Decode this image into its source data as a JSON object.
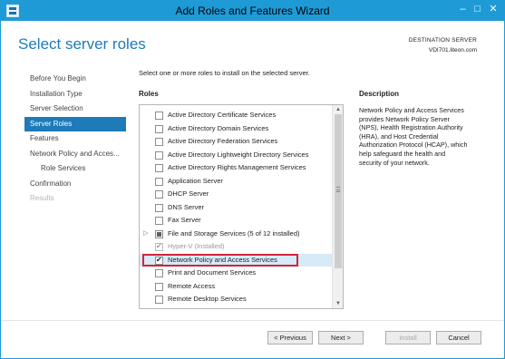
{
  "window": {
    "title": "Add Roles and Features Wizard",
    "minimize_glyph": "–",
    "maximize_glyph": "□",
    "close_glyph": "✕"
  },
  "header": {
    "page_title": "Select server roles",
    "destination_label": "DESTINATION SERVER",
    "destination_server": "VDI701.liteon.com"
  },
  "nav": {
    "items": [
      {
        "label": "Before You Begin",
        "state": "normal"
      },
      {
        "label": "Installation Type",
        "state": "normal"
      },
      {
        "label": "Server Selection",
        "state": "normal"
      },
      {
        "label": "Server Roles",
        "state": "active"
      },
      {
        "label": "Features",
        "state": "normal"
      },
      {
        "label": "Network Policy and Acces...",
        "state": "normal"
      },
      {
        "label": "Role Services",
        "state": "sub"
      },
      {
        "label": "Confirmation",
        "state": "normal"
      },
      {
        "label": "Results",
        "state": "disabled"
      }
    ]
  },
  "main": {
    "instruction": "Select one or more roles to install on the selected server.",
    "roles_heading": "Roles",
    "description_heading": "Description",
    "description_text": "Network Policy and Access Services provides Network Policy Server (NPS), Health Registration Authority (HRA), and Host Credential Authorization Protocol (HCAP), which help safeguard the health and security of your network.",
    "roles": [
      {
        "label": "Active Directory Certificate Services",
        "checked": false
      },
      {
        "label": "Active Directory Domain Services",
        "checked": false
      },
      {
        "label": "Active Directory Federation Services",
        "checked": false
      },
      {
        "label": "Active Directory Lightweight Directory Services",
        "checked": false
      },
      {
        "label": "Active Directory Rights Management Services",
        "checked": false
      },
      {
        "label": "Application Server",
        "checked": false
      },
      {
        "label": "DHCP Server",
        "checked": false
      },
      {
        "label": "DNS Server",
        "checked": false
      },
      {
        "label": "Fax Server",
        "checked": false
      },
      {
        "label": "File and Storage Services (5 of 12 installed)",
        "checked": "partial",
        "expandable": true
      },
      {
        "label": "Hyper-V (Installed)",
        "checked": true,
        "disabled": true
      },
      {
        "label": "Network Policy and Access Services",
        "checked": true,
        "selected": true
      },
      {
        "label": "Print and Document Services",
        "checked": false
      },
      {
        "label": "Remote Access",
        "checked": false
      },
      {
        "label": "Remote Desktop Services",
        "checked": false
      }
    ]
  },
  "footer": {
    "previous": "< Previous",
    "next": "Next >",
    "install": "Install",
    "cancel": "Cancel"
  },
  "colors": {
    "titlebar": "#1e9bd7",
    "accent": "#1e7ab8",
    "selection_outline": "#d0243a"
  }
}
